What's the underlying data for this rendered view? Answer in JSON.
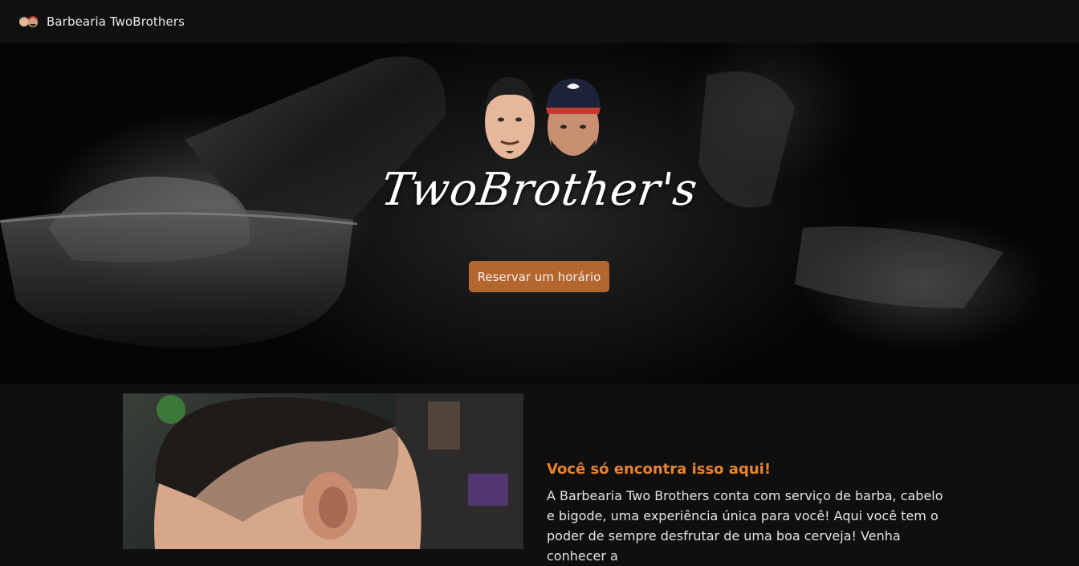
{
  "navbar": {
    "brand_title": "Barbearia TwoBrothers",
    "logo_icon": "two-brothers-faces-icon"
  },
  "hero": {
    "logo_title": "TwoBrother's",
    "reserve_button_label": "Reservar um horário",
    "background_image": "shaving-brush-photo",
    "avatars_icon": "two-brothers-avatars"
  },
  "feature": {
    "image": "haircut-fade-photo",
    "heading": "Você só encontra isso aqui!",
    "text": "A Barbearia Two Brothers conta com serviço de barba, cabelo e bigode, uma experiência única para você! Aqui você tem o poder de sempre desfrutar de uma boa cerveja! Venha conhecer a"
  },
  "colors": {
    "accent": "#b3662d",
    "heading_accent": "#e8842f",
    "navbar_bg": "#101011",
    "page_bg": "#0f0f10"
  }
}
